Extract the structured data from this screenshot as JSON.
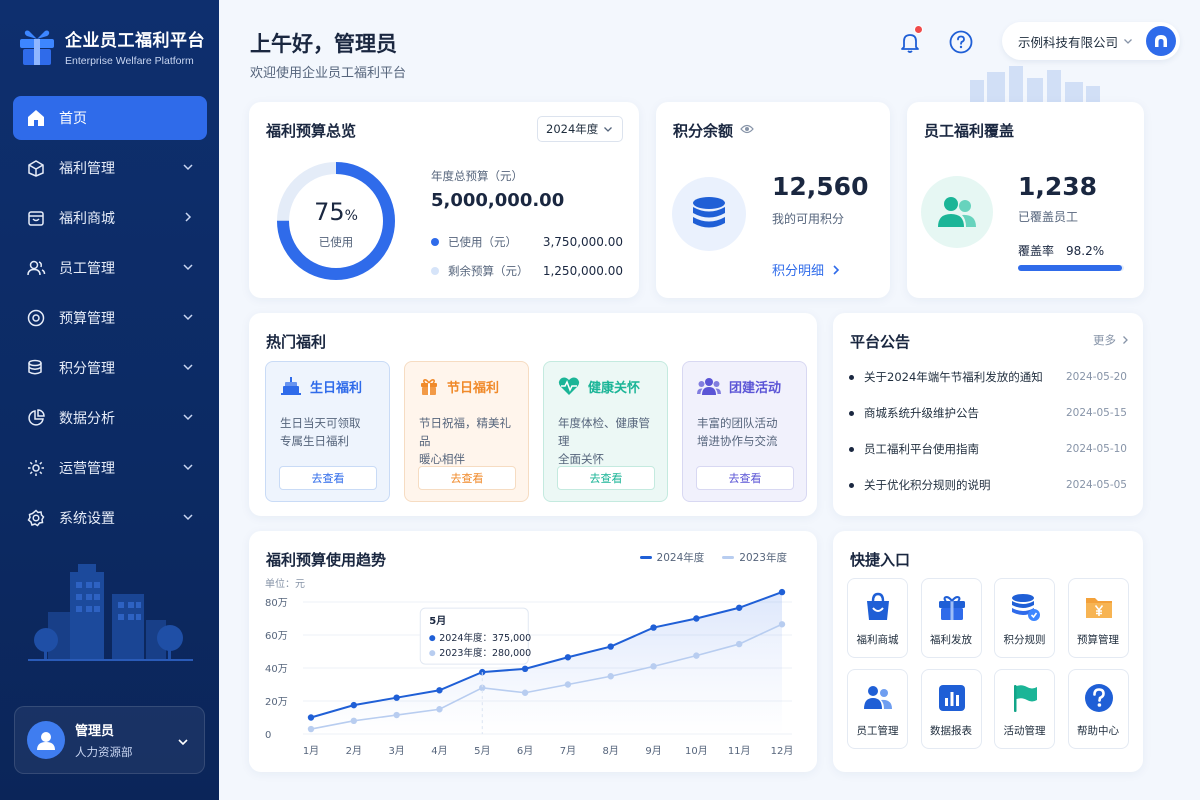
{
  "brand": {
    "title": "企业员工福利平台",
    "subtitle": "Enterprise Welfare Platform"
  },
  "nav": [
    {
      "label": "首页",
      "icon": "home-icon",
      "active": true
    },
    {
      "label": "福利管理",
      "icon": "gift-box-icon",
      "chevron": "down"
    },
    {
      "label": "福利商城",
      "icon": "store-icon",
      "chevron": "right"
    },
    {
      "label": "员工管理",
      "icon": "people-icon",
      "chevron": "down"
    },
    {
      "label": "预算管理",
      "icon": "budget-icon",
      "chevron": "down"
    },
    {
      "label": "积分管理",
      "icon": "coins-icon",
      "chevron": "down"
    },
    {
      "label": "数据分析",
      "icon": "pie-chart-icon",
      "chevron": "down"
    },
    {
      "label": "运营管理",
      "icon": "settings-icon",
      "chevron": "down"
    },
    {
      "label": "系统设置",
      "icon": "gear-icon",
      "chevron": "down"
    }
  ],
  "user": {
    "name": "管理员",
    "dept": "人力资源部"
  },
  "header": {
    "greeting": "上午好，管理员",
    "subtitle": "欢迎使用企业员工福利平台",
    "company": "示例科技有限公司"
  },
  "budget": {
    "title": "福利预算总览",
    "year_select": "2024年度",
    "percent": "75",
    "percent_unit": "%",
    "percent_value": 0.75,
    "percent_label": "已使用",
    "total_label": "年度总预算（元）",
    "total": "5,000,000.00",
    "used_label": "已使用（元）",
    "used": "3,750,000.00",
    "remain_label": "剩余预算（元）",
    "remain": "1,250,000.00"
  },
  "points": {
    "title": "积分余额",
    "value": "12,560",
    "label": "我的可用积分",
    "link": "积分明细"
  },
  "coverage": {
    "title": "员工福利覆盖",
    "value": "1,238",
    "label": "已覆盖员工",
    "rate_label": "覆盖率",
    "rate": "98.2%",
    "rate_value": 0.982
  },
  "hot": {
    "title": "热门福利",
    "items": [
      {
        "title": "生日福利",
        "line1": "生日当天可领取",
        "line2": "专属生日福利",
        "button": "去查看",
        "color": "#2f6bea",
        "bg": "#eef4fd",
        "border": "#c9dbf6"
      },
      {
        "title": "节日福利",
        "line1": "节日祝福，精美礼品",
        "line2": "暖心相伴",
        "button": "去查看",
        "color": "#f08a2a",
        "bg": "#fff5ec",
        "border": "#f6dcc2"
      },
      {
        "title": "健康关怀",
        "line1": "年度体检、健康管理",
        "line2": "全面关怀",
        "button": "去查看",
        "color": "#1bb597",
        "bg": "#ecf8f5",
        "border": "#c4eadf"
      },
      {
        "title": "团建活动",
        "line1": "丰富的团队活动",
        "line2": "增进协作与交流",
        "button": "去查看",
        "color": "#5b55d6",
        "bg": "#f1f1fc",
        "border": "#d8d8f2"
      }
    ]
  },
  "announce": {
    "title": "平台公告",
    "more": "更多",
    "items": [
      {
        "text": "关于2024年端午节福利发放的通知",
        "date": "2024-05-20"
      },
      {
        "text": "商城系统升级维护公告",
        "date": "2024-05-15"
      },
      {
        "text": "员工福利平台使用指南",
        "date": "2024-05-10"
      },
      {
        "text": "关于优化积分规则的说明",
        "date": "2024-05-05"
      }
    ]
  },
  "chart_data": {
    "type": "line",
    "title": "福利预算使用趋势",
    "unit_label": "单位：元",
    "x": [
      "1月",
      "2月",
      "3月",
      "4月",
      "5月",
      "6月",
      "7月",
      "8月",
      "9月",
      "10月",
      "11月",
      "12月"
    ],
    "y_ticks": [
      "0",
      "20万",
      "40万",
      "60万",
      "80万"
    ],
    "ylim": [
      0,
      800000
    ],
    "series": [
      {
        "name": "2024年度",
        "color": "#1f5fd6",
        "values": [
          100000,
          175000,
          220000,
          265000,
          375000,
          395000,
          465000,
          530000,
          645000,
          700000,
          765000,
          860000
        ]
      },
      {
        "name": "2023年度",
        "color": "#b8cdf0",
        "values": [
          30000,
          80000,
          115000,
          150000,
          280000,
          250000,
          300000,
          350000,
          410000,
          475000,
          545000,
          665000
        ]
      }
    ],
    "tooltip": {
      "month": "5月",
      "index": 4,
      "row1": "2024年度：375,000",
      "row2": "2023年度：280,000"
    }
  },
  "quick": {
    "title": "快捷入口",
    "items": [
      {
        "label": "福利商城",
        "icon": "shopping-bag-icon"
      },
      {
        "label": "福利发放",
        "icon": "gift-icon"
      },
      {
        "label": "积分规则",
        "icon": "coin-stack-icon"
      },
      {
        "label": "预算管理",
        "icon": "folder-yuan-icon"
      },
      {
        "label": "员工管理",
        "icon": "employees-icon"
      },
      {
        "label": "数据报表",
        "icon": "bar-chart-icon"
      },
      {
        "label": "活动管理",
        "icon": "flag-icon"
      },
      {
        "label": "帮助中心",
        "icon": "help-icon"
      }
    ]
  }
}
